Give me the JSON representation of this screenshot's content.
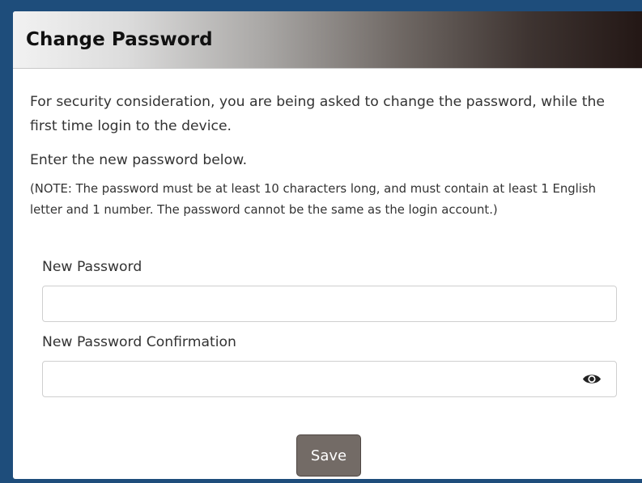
{
  "dialog": {
    "title": "Change Password",
    "message": "For security consideration, you are being asked to change the password, while the first time login to the device.",
    "instruction": "Enter the new password below.",
    "note": "(NOTE: The password must be at least 10 characters long, and must contain at least 1 English letter and 1 number. The password cannot be the same as the login account.)"
  },
  "form": {
    "new_password_label": "New Password",
    "new_password_value": "",
    "confirm_label": "New Password Confirmation",
    "confirm_value": "",
    "confirm_icon": "eye-icon"
  },
  "actions": {
    "save_label": "Save"
  },
  "colors": {
    "page_background": "#1e4d7b",
    "save_button": "#736b66",
    "header_gradient_end": "#231715"
  }
}
